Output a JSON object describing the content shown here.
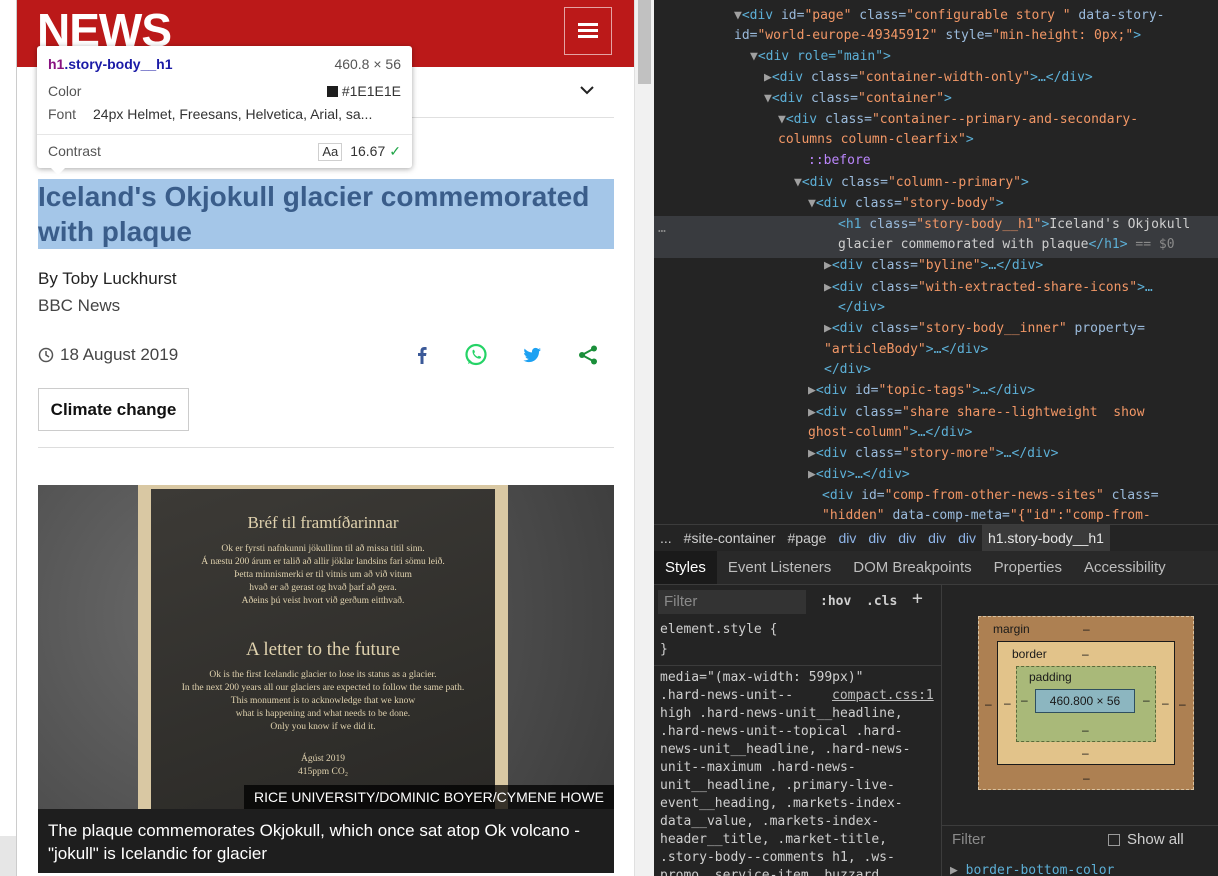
{
  "masthead": {
    "logo_text": "NEWS",
    "brand_color": "#bb1919"
  },
  "tooltip": {
    "selector_tag": "h1",
    "selector_class": ".story-body__h1",
    "dimensions": "460.8 × 56",
    "color_label": "Color",
    "color_value": "#1E1E1E",
    "font_label": "Font",
    "font_value": "24px Helmet, Freesans, Helvetica, Arial, sa...",
    "contrast_label": "Contrast",
    "contrast_aa": "Aa",
    "contrast_value": "16.67"
  },
  "article": {
    "headline": "Iceland's Okjokull glacier commemorated with plaque",
    "author": "By Toby Luckhurst",
    "org": "BBC News",
    "date": "18 August 2019",
    "tag": "Climate change",
    "image_credit": "RICE UNIVERSITY/DOMINIC BOYER/CYMENE HOWE",
    "caption": "The plaque commemorates Okjokull, which once sat atop Ok volcano - \"jokull\" is Icelandic for glacier",
    "plaque": {
      "title_is": "Bréf til framtíðarinnar",
      "body_is": [
        "Ok er fyrsti nafnkunni jökullinn til að missa titil sinn.",
        "Á næstu 200 árum er talið að allir jöklar landsins fari sömu leið.",
        "Þetta minnismerki er til vitnis um að við vitum",
        "hvað er að gerast og hvað þarf að gera.",
        "Aðeins þú veist hvort við gerðum eitthvað."
      ],
      "title_en": "A letter to the future",
      "body_en": [
        "Ok is the first Icelandic glacier to lose its status as a glacier.",
        "In the next 200 years all our glaciers are expected to follow the same path.",
        "This monument is to acknowledge that we know",
        "what is happening and what needs to be done.",
        "Only you know if we did it."
      ],
      "date": "Ágúst 2019",
      "co2": "415ppm CO₂"
    }
  },
  "devtools": {
    "tree": {
      "l1_tag": "<div",
      "l1_a1": " id=",
      "l1_v1": "\"page\"",
      "l1_a2": " class=",
      "l1_v2": "\"configurable story \"",
      "l1_a3": " data-story-",
      "l1b_a3": "id=",
      "l1b_v3": "\"world-europe-49345912\"",
      "l1b_a4": " style=",
      "l1b_v4": "\"min-height: 0px;\"",
      "l1b_end": ">",
      "l2": "<div role=\"main\">",
      "l3_a": "<div",
      "l3_b": " class=",
      "l3_c": "\"container-width-only\"",
      "l3_d": ">…</div>",
      "l4_b": " class=",
      "l4_c": "\"container\"",
      "l4_d": ">",
      "l5_c": "\"container--primary-and-secondary-",
      "l5b": "columns column-clearfix\"",
      "l5b_end": ">",
      "l6": "::before",
      "l7_c": "\"column--primary\"",
      "l8_c": "\"story-body\"",
      "l9_tag": "<h1",
      "l9_c": "\"story-body__h1\"",
      "l9_t": "Iceland's Okjokull",
      "l9b_t": "glacier commemorated with plaque",
      "l9b_end": "</h1>",
      "l9b_eq": " == $0",
      "l10_c": "\"byline\"",
      "l10_d": ">…</div>",
      "l11_c": "\"with-extracted-share-icons\"",
      "l11_d": ">…",
      "l11b": "</div>",
      "l12_c": "\"story-body__inner\"",
      "l12_p": " property=",
      "l12b_v": "\"articleBody\"",
      "l12b_d": ">…</div>",
      "l13": "</div>",
      "l14_a": " id=",
      "l14_c": "\"topic-tags\"",
      "l14_d": ">…</div>",
      "l15_c": "\"share share--lightweight  show",
      "l15b": "ghost-column\"",
      "l15b_d": ">…</div>",
      "l16_c": "\"story-more\"",
      "l16_d": ">…</div>",
      "l17": "<div>…</div>",
      "l18_a": " id=",
      "l18_c": "\"comp-from-other-news-sites\"",
      "l18_cl": " class=",
      "l19_v": "\"hidden\"",
      "l19_a": " data-comp-meta=",
      "l19_v2": "\"{\"id\":\"comp-from-"
    },
    "ellipsis": "…",
    "breadcrumbs": [
      "...",
      "#site-container",
      "#page",
      "div",
      "div",
      "div",
      "div",
      "div",
      "h1.story-body__h1"
    ],
    "tabs": [
      "Styles",
      "Event Listeners",
      "DOM Breakpoints",
      "Properties",
      "Accessibility"
    ],
    "styles": {
      "filter_placeholder": "Filter",
      "hov": ":hov",
      "cls": ".cls",
      "plus": "+",
      "element_style": "element.style {",
      "element_style_close": "}",
      "media": "media=\"(max-width: 599px)\"",
      "link": "compact.css:1",
      "rule_lines": [
        ".hard-news-unit--",
        "high .hard-news-unit__headline,",
        ".hard-news-unit--topical .hard-",
        "news-unit__headline, .hard-news-",
        "unit--maximum .hard-news-",
        "unit__headline, .primary-live-",
        "event__heading, .markets-index-",
        "data__value, .markets-index-",
        "header__title, .market-title,",
        ".story-body--comments h1, .ws-",
        "promo  service-item  buzzard"
      ]
    },
    "box_model": {
      "margin_label": "margin",
      "border_label": "border",
      "padding_label": "padding",
      "content": "460.800 × 56",
      "dash": "–",
      "filter_label": "Filter",
      "show_all": "Show all",
      "computed_first": "border-bottom-color"
    }
  }
}
